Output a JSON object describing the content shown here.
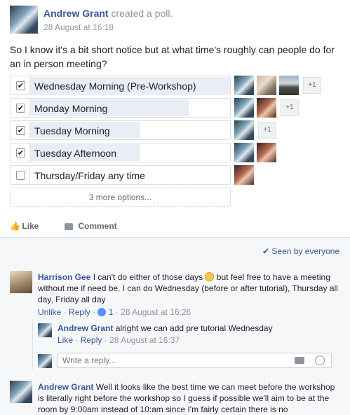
{
  "post": {
    "author": "Andrew Grant",
    "action": "created a poll.",
    "timestamp": "28 August at 16:18",
    "text": "So I know it's a bit short notice but at what time's roughly can people do for an in person meeting?"
  },
  "poll": {
    "options": [
      {
        "label": "Wednesday Morning (Pre-Workshop)",
        "checked": true,
        "fill": 1.0,
        "voters": [
          "avatar-a",
          "avatar-b",
          "avatar-c"
        ],
        "more": "+1"
      },
      {
        "label": "Monday Morning",
        "checked": true,
        "fill": 0.79,
        "voters": [
          "avatar-a",
          "avatar-d"
        ],
        "more": "+1"
      },
      {
        "label": "Tuesday Morning",
        "checked": true,
        "fill": 0.55,
        "voters": [
          "avatar-a"
        ],
        "more": "+1"
      },
      {
        "label": "Tuesday Afternoon",
        "checked": true,
        "fill": 0.55,
        "voters": [
          "avatar-a",
          "avatar-d"
        ],
        "more": ""
      },
      {
        "label": "Thursday/Friday any time",
        "checked": false,
        "fill": 0.0,
        "voters": [
          "avatar-d"
        ],
        "more": ""
      }
    ],
    "more_options": "3 more options..."
  },
  "actions": {
    "like": "Like",
    "comment": "Comment"
  },
  "seen": "Seen by everyone",
  "comments": [
    {
      "name": "Harrison Gee",
      "text_before_emoji": "I can't do either of those days",
      "text_after_emoji": "but feel free to have a meeting without me if need be. I can do Wednesday (before or after tutorial), Thursday all day, Friday all day",
      "unlike": "Unlike",
      "reply": "Reply",
      "likes": "1",
      "time": "28 August at 16:26"
    },
    {
      "name": "Andrew Grant",
      "text": "alright we can add pre tutorial Wednesday",
      "like": "Like",
      "reply": "Reply",
      "time": "28 August at 16:37"
    },
    {
      "name": "Andrew Grant",
      "text": "Well it looks like the best time we can meet before the workshop is literally right before the workshop so I guess if possible we'll aim to be at the room by 9:00am instead of 10:am since I'm fairly certain there is no"
    }
  ],
  "reply_box": {
    "placeholder": "Write a reply..."
  },
  "colors": {
    "link": "#365899",
    "poll_fill": "#e9eef6",
    "comment_bg": "#f6f7f9"
  }
}
